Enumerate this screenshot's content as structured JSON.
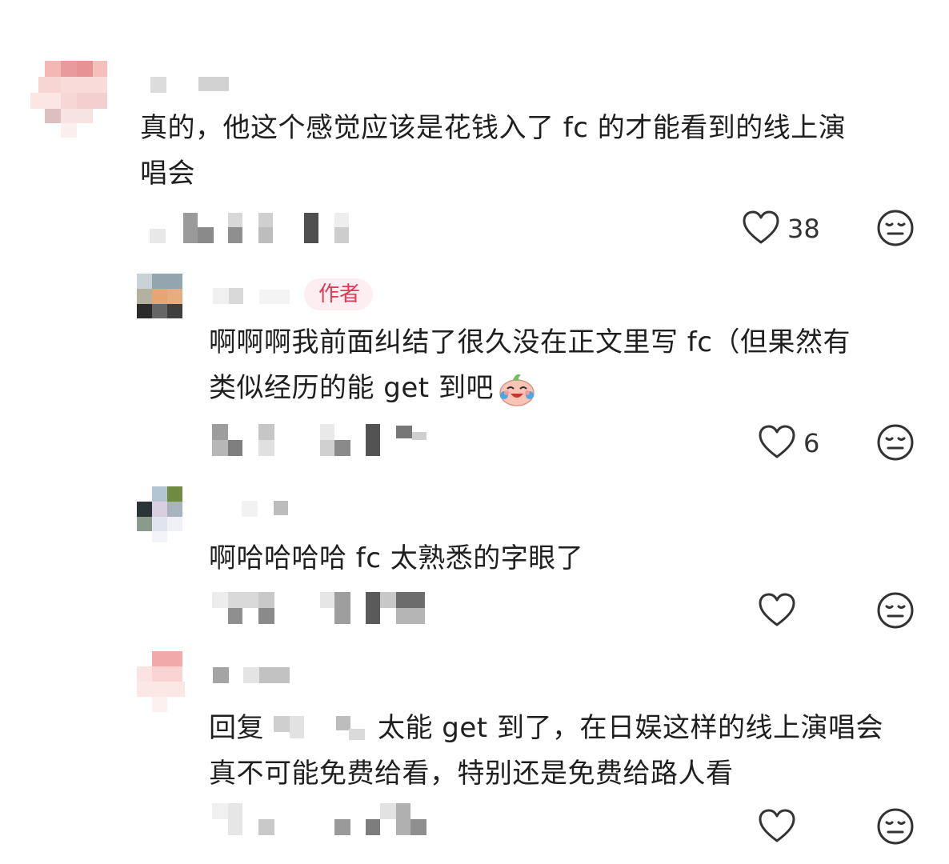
{
  "comments": [
    {
      "text_line1": "真的，他这个感觉应该是花钱入了 fc 的才能看到的线上演",
      "text_line2": "唱会",
      "likes": "38"
    },
    {
      "badge": "作者",
      "text_line1": "啊啊啊我前面纠结了很久没在正文里写 fc（但果然有",
      "text_line2": "类似经历的能 get 到吧",
      "emoji": "crying-laughing-baby-emoji",
      "likes": "6"
    },
    {
      "text_line1": "啊哈哈哈哈 fc 太熟悉的字眼了",
      "likes": ""
    },
    {
      "reply_prefix": "回复",
      "text_line1_rest": "太能 get 到了，在日娱这样的线上演唱会",
      "text_line2": "真不可能免费给看，特别还是免费给路人看",
      "likes": ""
    }
  ],
  "icons": {
    "like": "heart-outline-icon",
    "dislike": "meh-face-icon"
  },
  "colors": {
    "badge_text": "#e33a54",
    "badge_bg": "#fdeff1",
    "icon_stroke": "#333333"
  }
}
